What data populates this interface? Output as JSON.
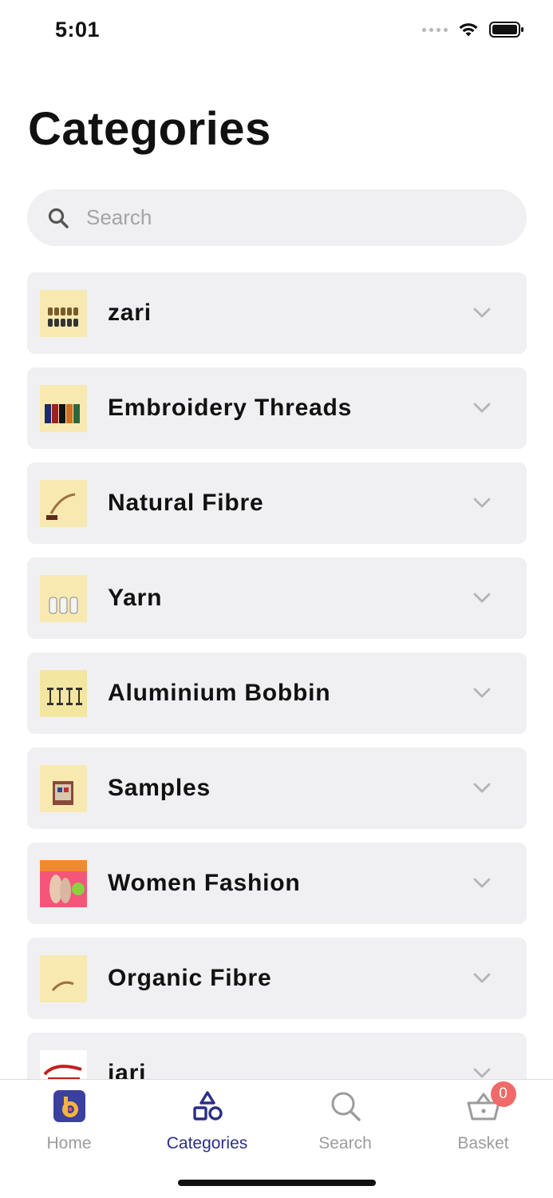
{
  "status_bar": {
    "time": "5:01"
  },
  "header": {
    "title": "Categories"
  },
  "search": {
    "placeholder": "Search"
  },
  "categories": [
    {
      "label": "zari"
    },
    {
      "label": "Embroidery Threads"
    },
    {
      "label": "Natural Fibre"
    },
    {
      "label": "Yarn"
    },
    {
      "label": "Aluminium Bobbin"
    },
    {
      "label": "Samples"
    },
    {
      "label": "Women Fashion"
    },
    {
      "label": "Organic Fibre"
    },
    {
      "label": "jari"
    }
  ],
  "tab_bar": {
    "home_label": "Home",
    "categories_label": "Categories",
    "search_label": "Search",
    "basket_label": "Basket",
    "basket_count": "0"
  },
  "colors": {
    "accent": "#2b2f86",
    "card_bg": "#f0f0f2",
    "badge": "#f06a6a",
    "thumb_bg": "#f6e6a4"
  }
}
